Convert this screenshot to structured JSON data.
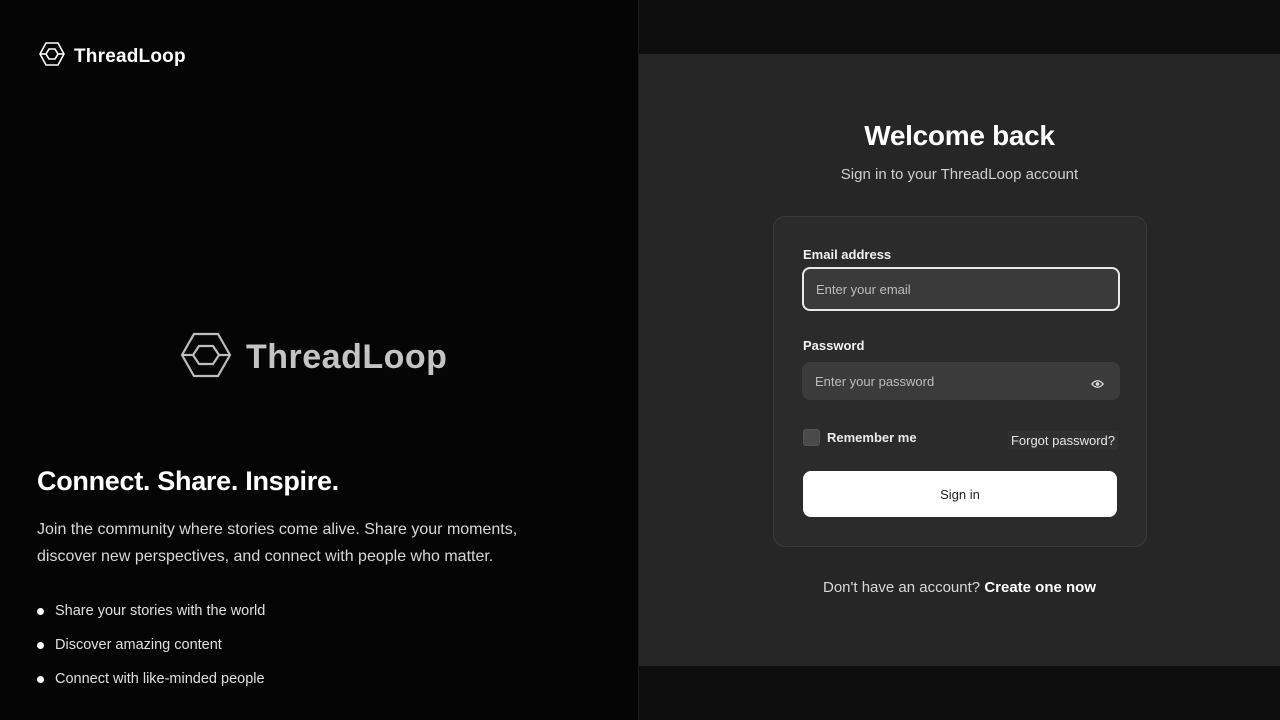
{
  "brand": {
    "name": "ThreadLoop",
    "icon": "hexagon-loop-icon"
  },
  "left": {
    "hero_name": "ThreadLoop",
    "tagline": "Connect. Share. Inspire.",
    "description": "Join the community where stories come alive. Share your moments, discover new perspectives, and connect with people who matter.",
    "features": [
      "Share your stories with the world",
      "Discover amazing content",
      "Connect with like-minded people"
    ]
  },
  "login": {
    "title": "Welcome back",
    "subtitle": "Sign in to your ThreadLoop account",
    "email_label": "Email address",
    "email_placeholder": "Enter your email",
    "email_value": "",
    "password_label": "Password",
    "password_placeholder": "Enter your password",
    "password_value": "",
    "password_toggle_icon": "eye-icon",
    "remember_label": "Remember me",
    "remember_checked": false,
    "forgot_label": "Forgot password?",
    "signin_label": "Sign in",
    "signup_prompt": "Don't have an account?",
    "signup_link": "Create one now"
  },
  "colors": {
    "left_bg": "#050505",
    "right_bg": "#262626",
    "card_bg": "#2b2b2b",
    "input_bg": "#3b3b3b",
    "button_bg": "#ffffff"
  }
}
